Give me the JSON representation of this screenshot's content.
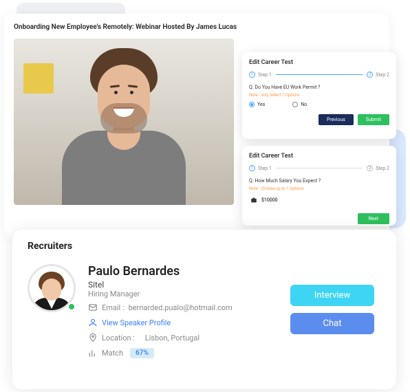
{
  "webinar": {
    "title": "Onboarding New Employee's Remotely: Webinar Hosted By James Lucas"
  },
  "card1": {
    "title": "Edit Career Test",
    "step1": "Step 1",
    "step2": "Step 2",
    "question": "Q. Do You Have EU Work Permit ?",
    "note": "Note : only Select 1 Options",
    "opt_yes": "Yes",
    "opt_no": "No",
    "btn_prev": "Previous",
    "btn_submit": "Submit"
  },
  "card2": {
    "title": "Edit Career Test",
    "step1": "Step 1",
    "step2": "Step 2",
    "question": "Q. How Much Salary You Expect ?",
    "note": "Note : Choose up to 1 Options",
    "salary_value": "$10000",
    "btn_next": "Next"
  },
  "recruiters": {
    "heading": "Recruiters",
    "name": "Paulo Bernardes",
    "company": "Sitel",
    "role": "Hiring Manager",
    "email_label": "Email :",
    "email": "bernarded.pualo@hotmail.com",
    "view_profile": "View Speaker Profile",
    "location_label": "Location :",
    "location": "Lisbon, Portugal",
    "match_label": "Match",
    "match_value": "67%",
    "btn_interview": "Interview",
    "btn_chat": "Chat"
  }
}
